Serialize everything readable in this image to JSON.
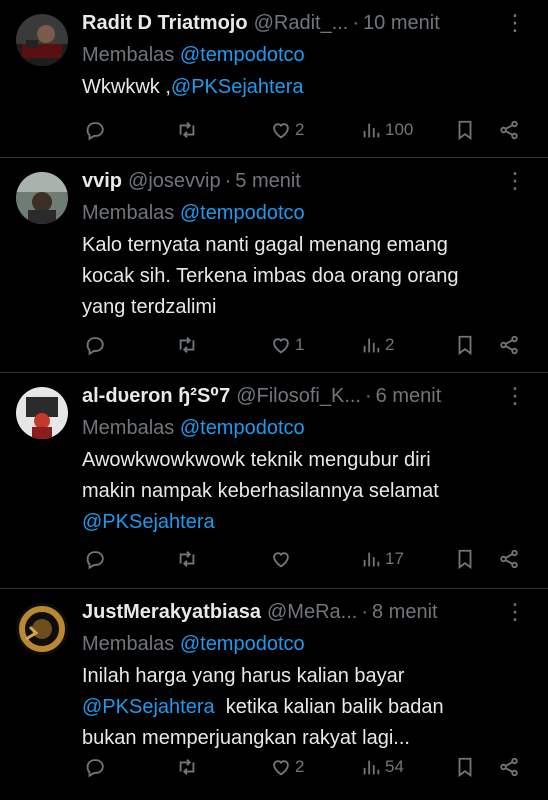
{
  "reply_prefix": "Membalas",
  "tweets": [
    {
      "name": "Radit D Triatmojo",
      "handle": "@Radit_...",
      "time": "10 menit",
      "reply_to": "@tempodotco",
      "text": "Wkwkwk ,",
      "mention": "@PKSejahtera",
      "likes": "2",
      "views": "100"
    },
    {
      "name": "vvip",
      "handle": "@josevvip",
      "time": "5 menit",
      "reply_to": "@tempodotco",
      "line1": "Kalo ternyata nanti gagal menang emang",
      "line2": "kocak sih. Terkena imbas doa orang orang",
      "line3": "yang terdzalimi",
      "likes": "1",
      "views": "2"
    },
    {
      "name": "al-dυeron ɧ²S⁰7",
      "handle": "@Filosofi_K...",
      "time": "6 menit",
      "reply_to": "@tempodotco",
      "line1": "Awowkwowkwowk teknik mengubur diri",
      "line2": "makin nampak keberhasilannya selamat",
      "mention": "@PKSejahtera",
      "views": "17"
    },
    {
      "name": "JustMerakyatbiasa",
      "handle": "@MeRa...",
      "time": "8 menit",
      "reply_to": "@tempodotco",
      "line1": "Inilah harga yang harus kalian bayar",
      "mention": "@PKSejahtera",
      "line2_rest": "ketika kalian balik badan",
      "line3": "bukan memperjuangkan rakyat lagi...",
      "likes": "2",
      "views": "54"
    }
  ],
  "colors": {
    "background": "#000000",
    "text": "#e7e9ea",
    "muted": "#71767b",
    "link": "#1d9bf0",
    "divider": "#2f3336"
  },
  "icons": [
    "reply-icon",
    "retweet-icon",
    "heart-icon",
    "views-icon",
    "bookmark-icon",
    "share-icon",
    "more-icon"
  ]
}
